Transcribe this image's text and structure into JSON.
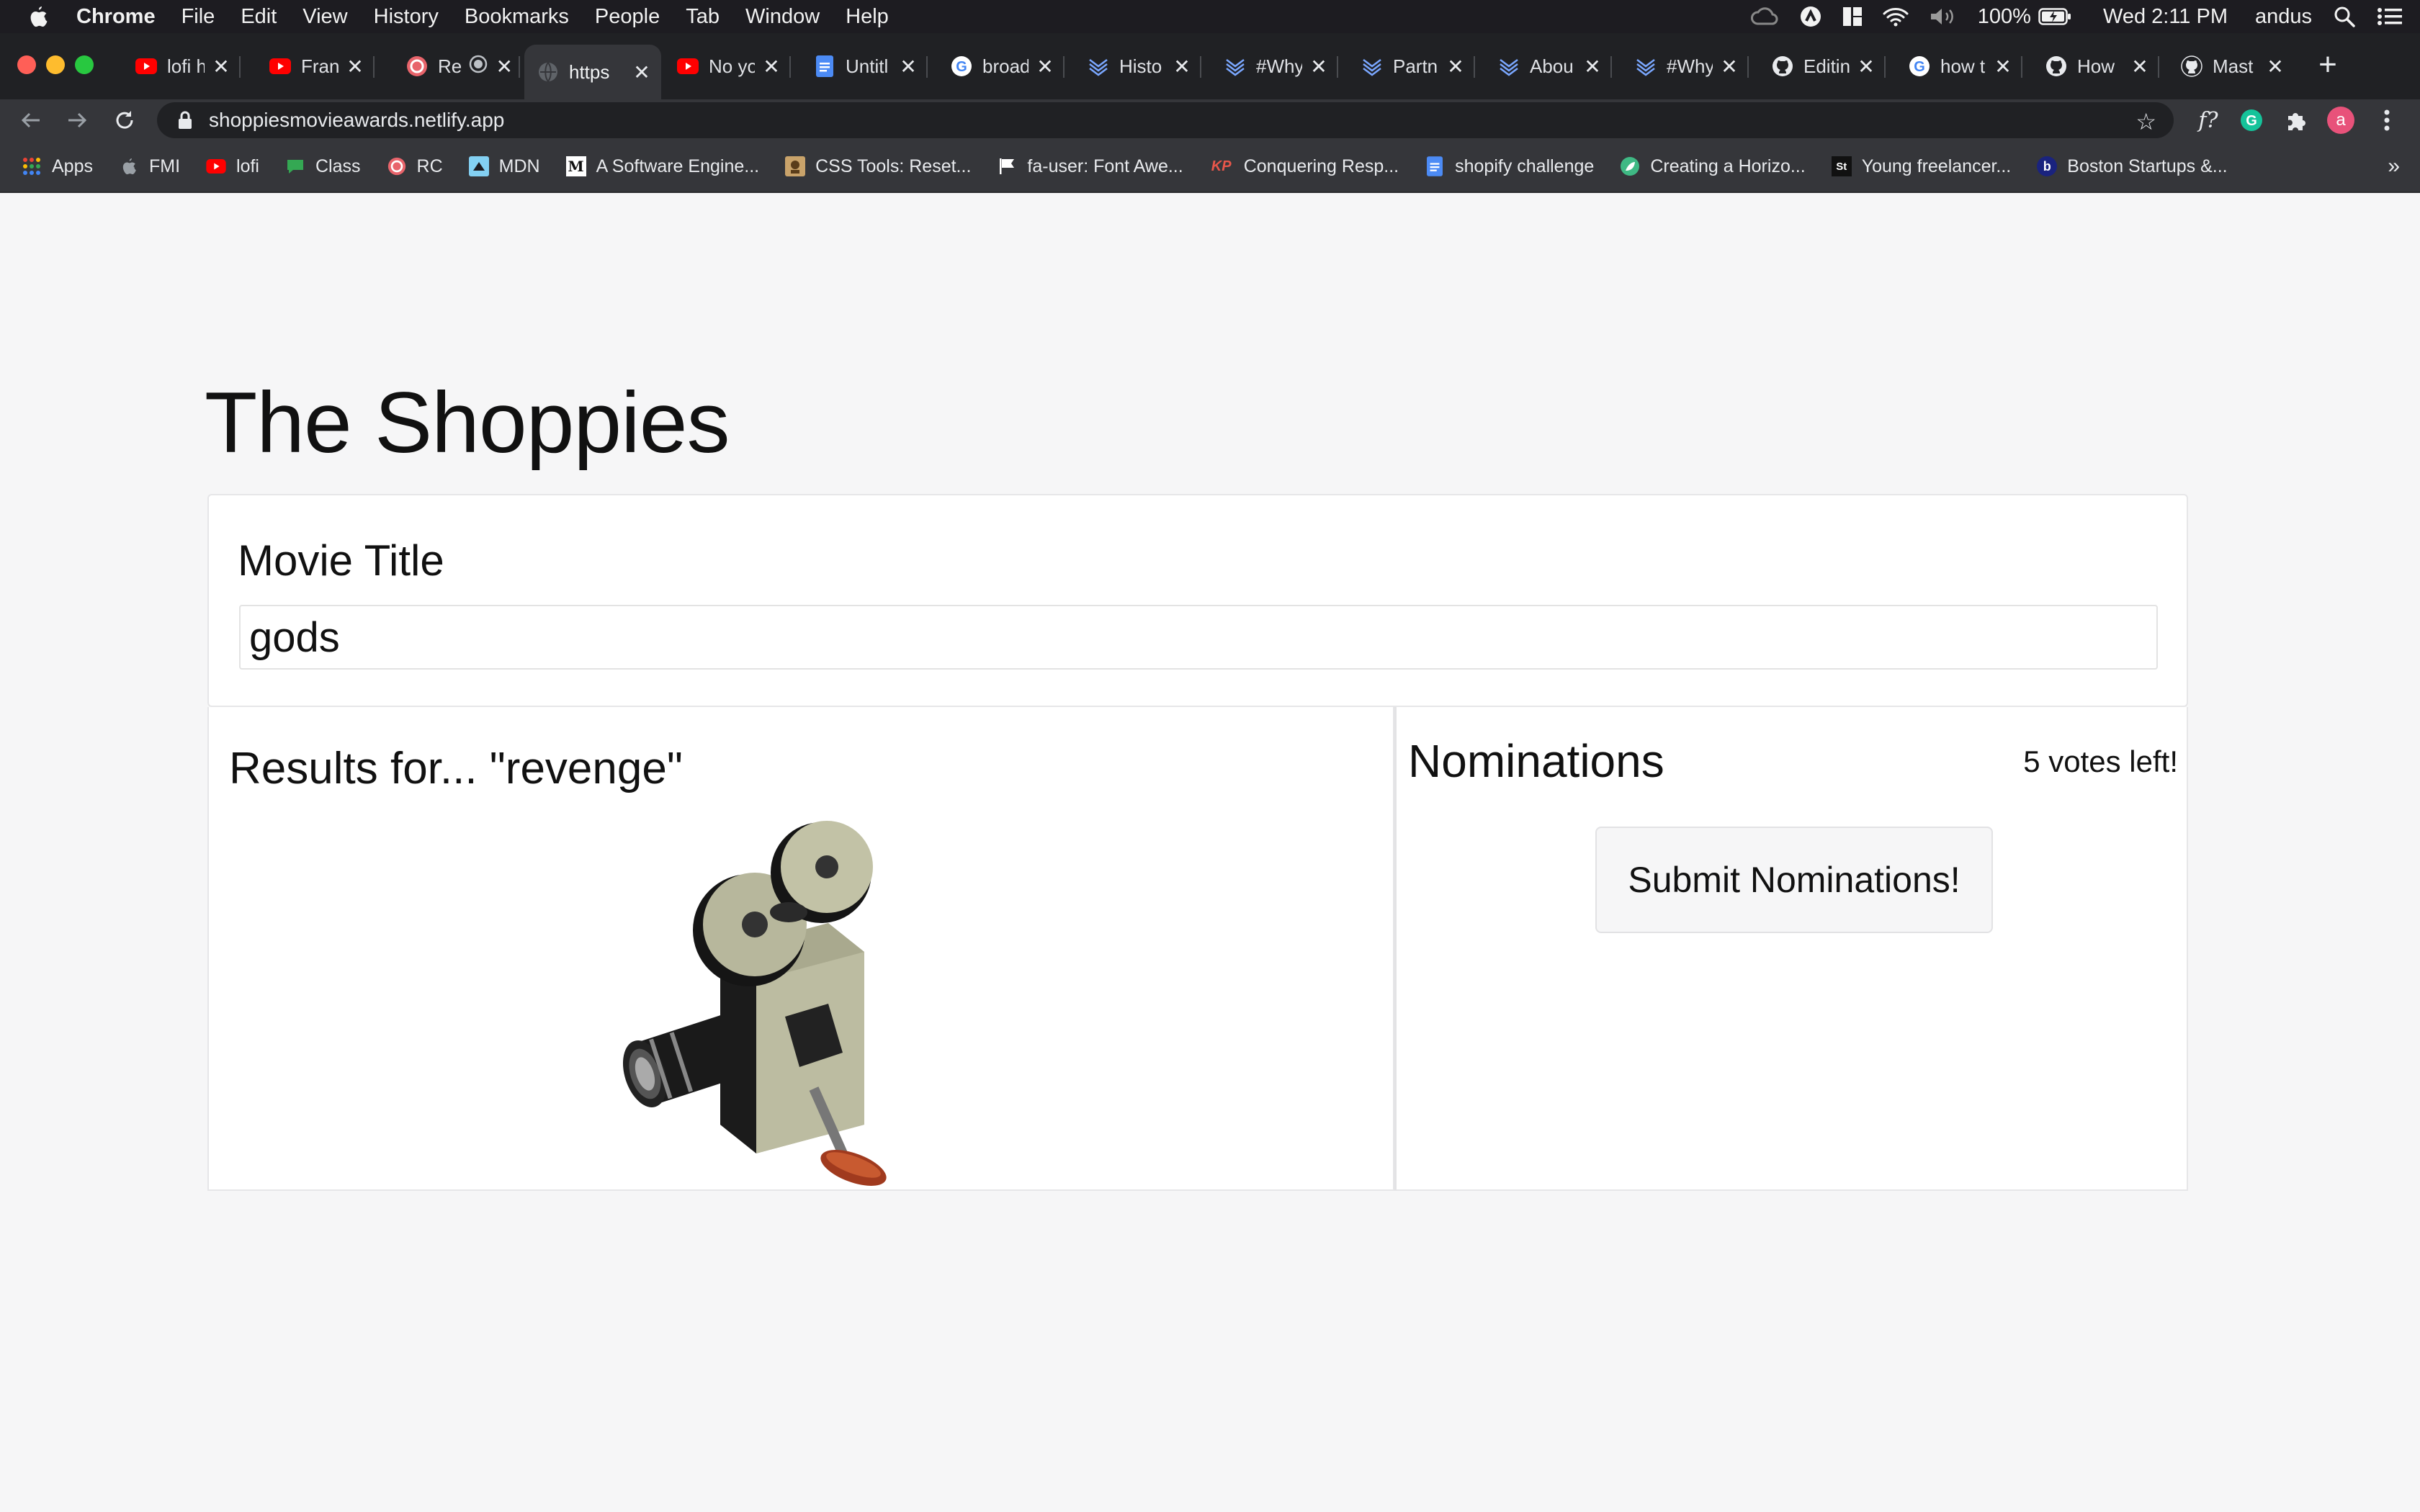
{
  "menubar": {
    "app_name": "Chrome",
    "items": [
      "File",
      "Edit",
      "View",
      "History",
      "Bookmarks",
      "People",
      "Tab",
      "Window",
      "Help"
    ],
    "battery": "100%",
    "datetime": "Wed 2:11 PM",
    "user": "andus"
  },
  "tabs": [
    {
      "title": "lofi hi",
      "icon": "youtube-icon"
    },
    {
      "title": "Frank",
      "icon": "youtube-icon"
    },
    {
      "title": "Re",
      "icon": "recurse-icon"
    },
    {
      "title": "https",
      "icon": "globe-icon",
      "active": true
    },
    {
      "title": "No yo",
      "icon": "youtube-icon"
    },
    {
      "title": "Untitl",
      "icon": "docs-icon"
    },
    {
      "title": "broad",
      "icon": "google-icon"
    },
    {
      "title": "Histo",
      "icon": "waves-icon"
    },
    {
      "title": "#Why",
      "icon": "waves-icon"
    },
    {
      "title": "Partn",
      "icon": "waves-icon"
    },
    {
      "title": "Abou",
      "icon": "waves-icon"
    },
    {
      "title": "#Why",
      "icon": "waves-icon"
    },
    {
      "title": "Editin",
      "icon": "github-icon"
    },
    {
      "title": "how t",
      "icon": "google-icon"
    },
    {
      "title": "How",
      "icon": "github-icon"
    },
    {
      "title": "Mast",
      "icon": "github-icon"
    }
  ],
  "toolbar": {
    "url": "shoppiesmovieawards.netlify.app",
    "avatar_letter": "a"
  },
  "bookmarks": [
    {
      "label": "Apps",
      "icon": "apps-grid-icon"
    },
    {
      "label": "FMI",
      "icon": "apple-icon"
    },
    {
      "label": "lofi",
      "icon": "youtube-icon"
    },
    {
      "label": "Class",
      "icon": "chat-icon"
    },
    {
      "label": "RC",
      "icon": "recurse-icon"
    },
    {
      "label": "MDN",
      "icon": "mdn-icon"
    },
    {
      "label": "A Software Engine...",
      "icon": "medium-icon"
    },
    {
      "label": "CSS Tools: Reset...",
      "icon": "css-tools-icon"
    },
    {
      "label": "fa-user: Font Awe...",
      "icon": "flag-icon"
    },
    {
      "label": "Conquering Resp...",
      "icon": "kp-icon"
    },
    {
      "label": "shopify challenge",
      "icon": "docs-icon"
    },
    {
      "label": "Creating a Horizo...",
      "icon": "leaf-icon"
    },
    {
      "label": "Young freelancer...",
      "icon": "si-icon"
    },
    {
      "label": "Boston Startups &...",
      "icon": "b-icon"
    }
  ],
  "page": {
    "title": "The Shoppies",
    "search_label": "Movie Title",
    "search_value": "gods",
    "results_title": "Results for... \"revenge\"",
    "nominations_title": "Nominations",
    "votes_left": "5 votes left!",
    "submit_label": "Submit Nominations!"
  },
  "colors": {
    "youtube": "#ff0000",
    "recurse": "#e8646b",
    "docs": "#4c8bf5",
    "waves": "#7aa7ff",
    "traffic_red": "#ff5f57",
    "traffic_yellow": "#febc2e",
    "traffic_green": "#28c840",
    "avatar": "#e8527a"
  }
}
